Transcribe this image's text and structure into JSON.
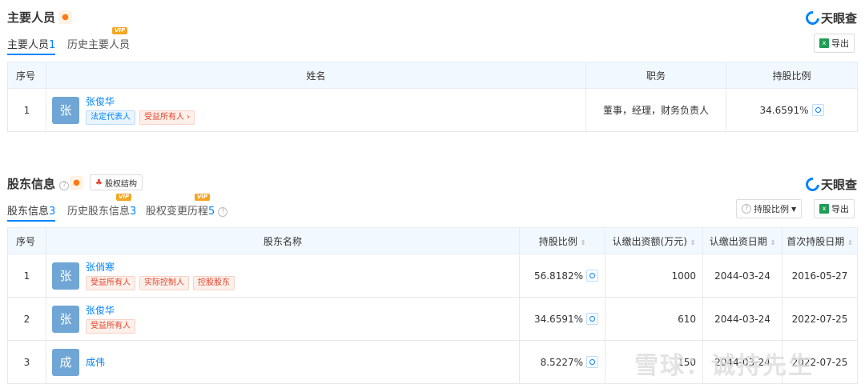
{
  "brand": "天眼查",
  "main_staff": {
    "title": "主要人员",
    "tabs": [
      {
        "label": "主要人员",
        "count": "1"
      },
      {
        "label": "历史主要人员",
        "vip": "VIP"
      }
    ],
    "export_label": "导出",
    "columns": [
      "序号",
      "姓名",
      "职务",
      "持股比例"
    ],
    "rows": [
      {
        "index": "1",
        "avatar": "张",
        "avatar_color": "#6fa6d6",
        "name": "张俊华",
        "tags": [
          "法定代表人",
          "受益所有人 ›"
        ],
        "position": "董事，经理，财务负责人",
        "ratio": "34.6591%"
      }
    ]
  },
  "shareholders": {
    "title": "股东信息",
    "structure_button": "股权结构",
    "tabs": [
      {
        "label": "股东信息",
        "count": "3"
      },
      {
        "label": "历史股东信息",
        "count": "3",
        "vip": "VIP"
      },
      {
        "label": "股权变更历程",
        "count": "5",
        "vip": "VIP"
      }
    ],
    "ratio_filter": "持股比例",
    "export_label": "导出",
    "columns": [
      "序号",
      "股东名称",
      "持股比例",
      "认缴出资额(万元)",
      "认缴出资日期",
      "首次持股日期"
    ],
    "rows": [
      {
        "index": "1",
        "avatar": "张",
        "avatar_color": "#6fa6d6",
        "name": "张俏寒",
        "tags": [
          "受益所有人",
          "实际控制人",
          "控股股东"
        ],
        "ratio": "56.8182%",
        "amount": "1000",
        "date": "2044-03-24",
        "first_date": "2016-05-27"
      },
      {
        "index": "2",
        "avatar": "张",
        "avatar_color": "#6fa6d6",
        "name": "张俊华",
        "tags": [
          "受益所有人"
        ],
        "ratio": "34.6591%",
        "amount": "610",
        "date": "2044-03-24",
        "first_date": "2022-07-25"
      },
      {
        "index": "3",
        "avatar": "成",
        "avatar_color": "#6fa6d6",
        "name": "成伟",
        "tags": [],
        "ratio": "8.5227%",
        "amount": "150",
        "date": "2044-03-24",
        "first_date": "2022-07-25"
      }
    ]
  },
  "watermark": "雪球：诚持先生"
}
